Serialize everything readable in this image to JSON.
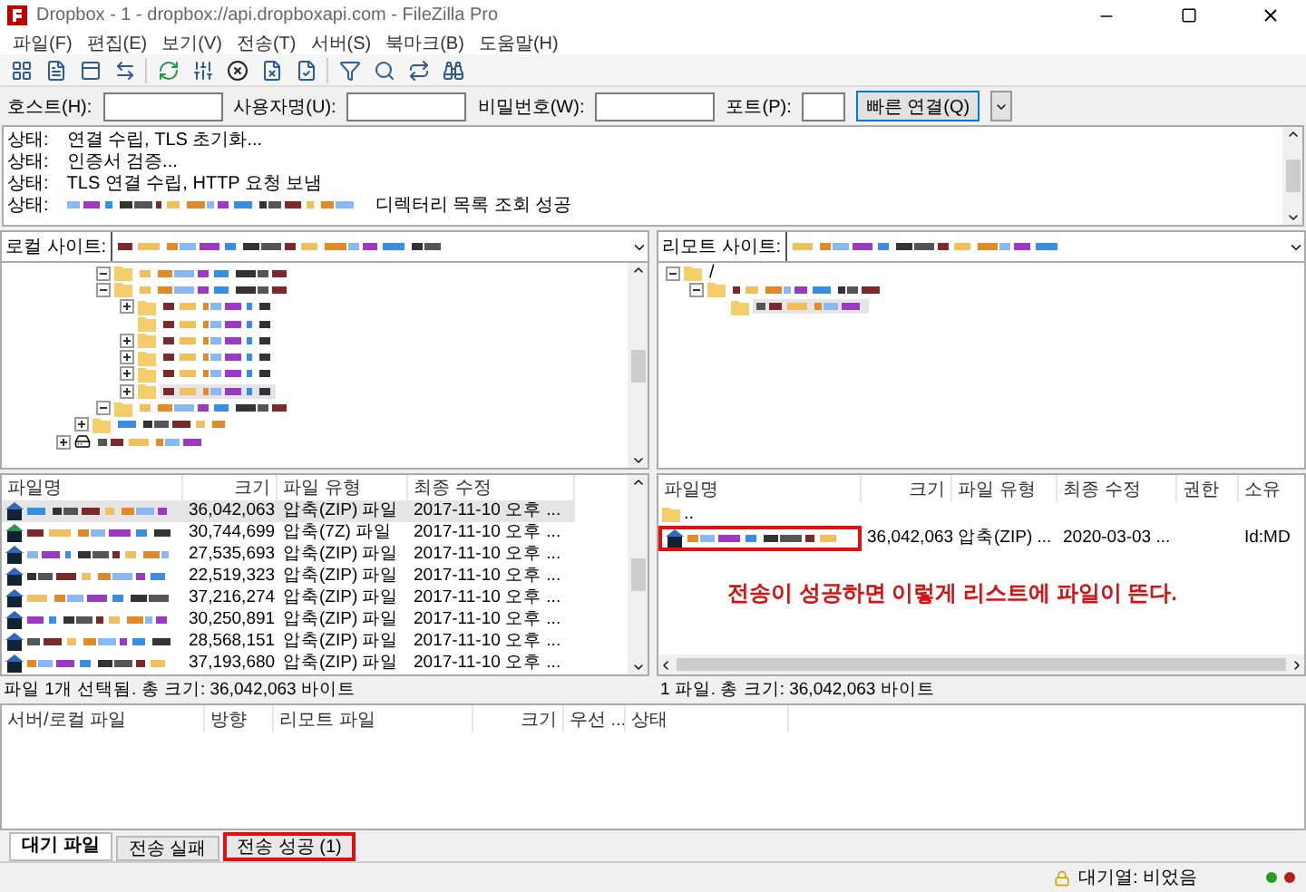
{
  "window": {
    "title": "Dropbox - 1 - dropbox://api.dropboxapi.com - FileZilla Pro"
  },
  "menu": [
    "파일(F)",
    "편집(E)",
    "보기(V)",
    "전송(T)",
    "서버(S)",
    "북마크(B)",
    "도움말(H)"
  ],
  "quickconnect": {
    "fields": [
      {
        "label": "호스트(H):"
      },
      {
        "label": "사용자명(U):"
      },
      {
        "label": "비밀번호(W):"
      },
      {
        "label": "포트(P):"
      }
    ],
    "button": "빠른 연결(Q)"
  },
  "log": [
    {
      "label": "상태:",
      "text": "연결 수립, TLS 초기화..."
    },
    {
      "label": "상태:",
      "text": "인증서 검증..."
    },
    {
      "label": "상태:",
      "text": "TLS 연결 수립, HTTP 요청 보냄"
    },
    {
      "label": "상태:",
      "text": "디렉터리 목록 조회 성공",
      "redacted_prefix": true
    }
  ],
  "local_site": {
    "label": "로컬 사이트:"
  },
  "remote_site": {
    "label": "리모트 사이트:"
  },
  "local_tree": {
    "branch": [
      {
        "kind": "folder",
        "expanded": true,
        "selected": false
      },
      {
        "kind": "folder",
        "expanded": true,
        "selected": false,
        "children": [
          {
            "kind": "folder",
            "expanded": false,
            "selected": false
          },
          {
            "kind": "leaf",
            "selected": false
          },
          {
            "kind": "folder",
            "expanded": false,
            "selected": false
          },
          {
            "kind": "folder",
            "expanded": false,
            "selected": false
          },
          {
            "kind": "folder",
            "expanded": false,
            "selected": false
          },
          {
            "kind": "folder",
            "expanded": false,
            "selected": true
          }
        ]
      },
      {
        "kind": "folder",
        "expanded": true,
        "selected": false
      }
    ],
    "siblings": [
      {
        "kind": "folder",
        "expanded": false,
        "selected": false
      }
    ],
    "drives": [
      {
        "kind": "drive",
        "expanded": false,
        "selected": false
      }
    ]
  },
  "remote_tree": [
    {
      "kind": "folder",
      "label": "/",
      "expanded": true,
      "selected": false,
      "children": [
        {
          "kind": "folder",
          "expanded": true,
          "selected": false,
          "children": [
            {
              "kind": "leaf",
              "selected": true
            }
          ]
        }
      ]
    }
  ],
  "local_files": {
    "columns": [
      "파일명",
      "크기",
      "파일 유형",
      "최종 수정"
    ],
    "rows": [
      {
        "kind": "zip",
        "size": "36,042,063",
        "type": "압축(ZIP) 파일",
        "modified": "2017-11-10 오후 ...",
        "selected": true
      },
      {
        "kind": "sevenzip",
        "size": "30,744,699",
        "type": "압축(7Z) 파일",
        "modified": "2017-11-10 오후 ...",
        "selected": false
      },
      {
        "kind": "zip",
        "size": "27,535,693",
        "type": "압축(ZIP) 파일",
        "modified": "2017-11-10 오후 ...",
        "selected": false
      },
      {
        "kind": "zip",
        "size": "22,519,323",
        "type": "압축(ZIP) 파일",
        "modified": "2017-11-10 오후 ...",
        "selected": false
      },
      {
        "kind": "zip",
        "size": "37,216,274",
        "type": "압축(ZIP) 파일",
        "modified": "2017-11-10 오후 ...",
        "selected": false
      },
      {
        "kind": "zip",
        "size": "30,250,891",
        "type": "압축(ZIP) 파일",
        "modified": "2017-11-10 오후 ...",
        "selected": false
      },
      {
        "kind": "zip",
        "size": "28,568,151",
        "type": "압축(ZIP) 파일",
        "modified": "2017-11-10 오후 ...",
        "selected": false
      },
      {
        "kind": "zip",
        "size": "37,193,680",
        "type": "압축(ZIP) 파일",
        "modified": "2017-11-10 오후 ...",
        "selected": false
      }
    ],
    "status": "파일 1개 선택됨. 총 크기: 36,042,063 바이트"
  },
  "remote_files": {
    "columns": [
      "파일명",
      "크기",
      "파일 유형",
      "최종 수정",
      "권한",
      "소유"
    ],
    "rows": [
      {
        "kind": "parent",
        "name": ".."
      },
      {
        "kind": "zip",
        "size": "36,042,063",
        "type": "압축(ZIP) ...",
        "modified": "2020-03-03 ...",
        "owner": "Id:MD",
        "highlighted": true
      }
    ],
    "annotation": "전송이 성공하면 이렇게 리스트에 파일이 뜬다.",
    "status": "1 파일. 총 크기: 36,042,063 바이트"
  },
  "queue": {
    "columns": [
      "서버/로컬 파일",
      "방향",
      "리모트 파일",
      "크기",
      "우선 ...",
      "상태"
    ]
  },
  "queue_tabs": [
    {
      "label": "대기 파일",
      "selected": true,
      "highlighted": false
    },
    {
      "label": "전송 실패",
      "selected": false,
      "highlighted": false
    },
    {
      "label": "전송 성공 (1)",
      "selected": false,
      "highlighted": true
    }
  ],
  "status_bar": {
    "queue": "대기열: 비었음",
    "lights": [
      {
        "color": "#22a022"
      },
      {
        "color": "#b02020"
      }
    ]
  }
}
